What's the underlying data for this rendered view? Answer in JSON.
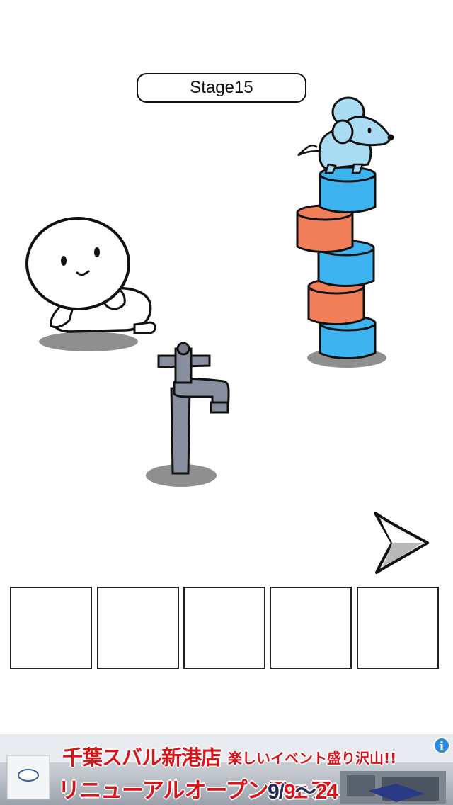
{
  "header": {
    "stage_label": "Stage15"
  },
  "scene": {
    "characters": [
      "ghost-character",
      "mouse-character"
    ],
    "objects": [
      "water-faucet",
      "stacked-cups"
    ]
  },
  "navigation": {
    "next_icon": "chevron-right-icon"
  },
  "inventory": {
    "slots": [
      "",
      "",
      "",
      "",
      ""
    ]
  },
  "ad": {
    "line1": "千葉スバル新港店",
    "line1b": "楽しいイベント盛り沢山!!",
    "line2": "リニューアルオープンフェア",
    "date_prefix": "9/",
    "date_start": "9",
    "date_sep": "〜",
    "date_end": "24",
    "info_icon": "i",
    "colors": {
      "headline": "#d8141b",
      "date": "#1f2a55"
    }
  },
  "colors": {
    "cup_blue": "#3db4ef",
    "cup_orange": "#f07f5a",
    "mouse": "#a9dcf2",
    "faucet": "#8a8f9f",
    "shadow": "#8f8f8f"
  }
}
